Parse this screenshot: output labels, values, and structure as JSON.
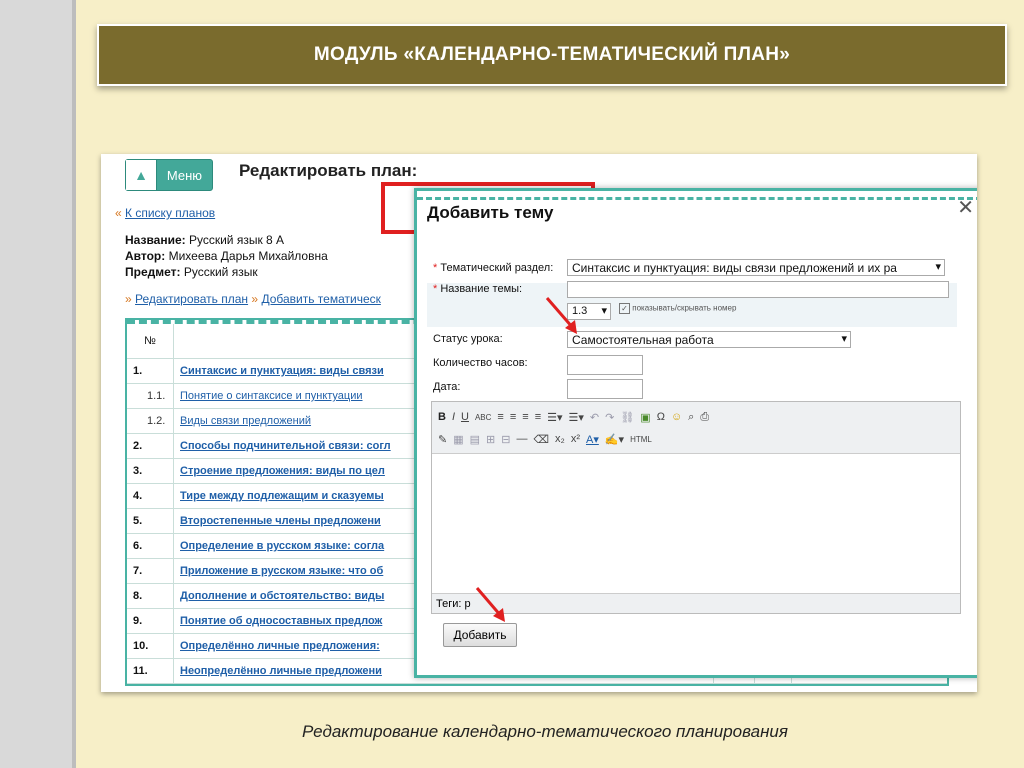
{
  "slide": {
    "title": "МОДУЛЬ «КАЛЕНДАРНО-ТЕМАТИЧЕСКИЙ ПЛАН»",
    "caption": "Редактирование календарно-тематического планирования"
  },
  "page": {
    "menu_label": "Меню",
    "heading": "Редактировать план:",
    "back_quote": "«",
    "back_link": "К списку планов",
    "meta": {
      "name_label": "Название:",
      "name_value": "Русский язык 8 А",
      "author_label": "Автор:",
      "author_value": "Михеева Дарья Михайловна",
      "subject_label": "Предмет:",
      "subject_value": "Русский язык"
    },
    "edit_links": {
      "q1": "»",
      "edit": "Редактировать план",
      "q2": "»",
      "add": "Добавить тематическ"
    }
  },
  "table": {
    "number_header": "№",
    "rows": [
      {
        "num": "1.",
        "title": "Синтаксис и пунктуация: виды связи",
        "sub": false
      },
      {
        "num": "1.1.",
        "title": "Понятие о синтаксисе и пунктуации",
        "sub": true
      },
      {
        "num": "1.2.",
        "title": "Виды связи предложений",
        "sub": true
      },
      {
        "num": "2.",
        "title": "Способы подчинительной связи: согл",
        "sub": false
      },
      {
        "num": "3.",
        "title": "Строение предложения: виды по цел",
        "sub": false
      },
      {
        "num": "4.",
        "title": "Тире между подлежащим и сказуемы",
        "sub": false
      },
      {
        "num": "5.",
        "title": "Второстепенные члены предложени",
        "sub": false
      },
      {
        "num": "6.",
        "title": "Определение в русском языке: согла",
        "sub": false
      },
      {
        "num": "7.",
        "title": "Приложение в русском языке: что об",
        "sub": false
      },
      {
        "num": "8.",
        "title": "Дополнение и обстоятельство: виды",
        "sub": false
      },
      {
        "num": "9.",
        "title": "Понятие об односоставных предлож",
        "sub": false
      },
      {
        "num": "10.",
        "title": "Определённо личные предложения:",
        "sub": false
      },
      {
        "num": "11.",
        "title": "Неопределённо личные предложени",
        "sub": false
      }
    ]
  },
  "dialog": {
    "title": "Добавить тему",
    "close": "✕",
    "section_label": "Тематический раздел:",
    "section_value": "Синтаксис и пунктуация: виды связи предложений и их ра",
    "topic_label": "Название темы:",
    "topic_value": "",
    "number_value": "1.3",
    "show_number_label": "показывать/скрывать номер",
    "status_label": "Статус урока:",
    "status_value": "Самостоятельная работа",
    "hours_label": "Количество часов:",
    "date_label": "Дата:",
    "tags_label": "Теги: p",
    "add_button": "Добавить",
    "required_mark": "*"
  },
  "colors": {
    "title_bar": "#7a6b2d",
    "accent": "#49b3a4",
    "highlight": "#e02020",
    "link": "#1f5fa8"
  }
}
